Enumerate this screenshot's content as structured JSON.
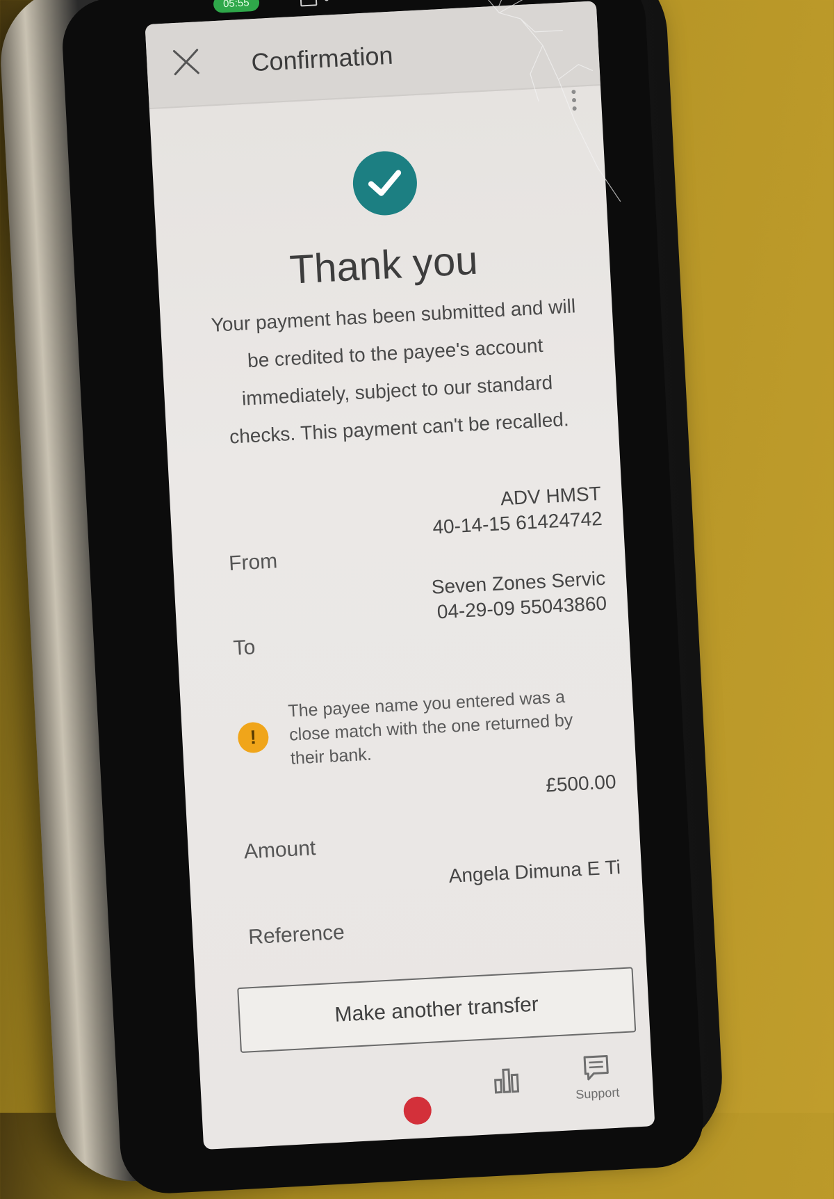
{
  "header": {
    "title": "Confirmation",
    "close_icon": "close-icon",
    "menu_icon": "more-vert-icon"
  },
  "status_bar": {
    "time": "05:55"
  },
  "confirmation": {
    "status_icon": "check-circle-icon",
    "heading": "Thank you",
    "message": "Your payment has been submitted and will be credited to the payee's account immediately, subject to our standard checks. This payment can't be recalled."
  },
  "details": {
    "from": {
      "label": "From",
      "name": "ADV HMST",
      "account": "40-14-15 61424742"
    },
    "to": {
      "label": "To",
      "name": "Seven Zones Servic",
      "account": "04-29-09 55043860"
    },
    "warning": {
      "icon": "warning-icon",
      "text": "The payee name you entered was a close match with the one returned by their bank."
    },
    "amount": {
      "label": "Amount",
      "value": "£500.00"
    },
    "reference": {
      "label": "Reference",
      "value": "Angela Dimuna E Ti"
    }
  },
  "actions": {
    "make_another_transfer": "Make another transfer"
  },
  "bottom_nav": {
    "support_label": "Support"
  },
  "colors": {
    "accent": "#1c7f82",
    "warning": "#f0a51a"
  }
}
